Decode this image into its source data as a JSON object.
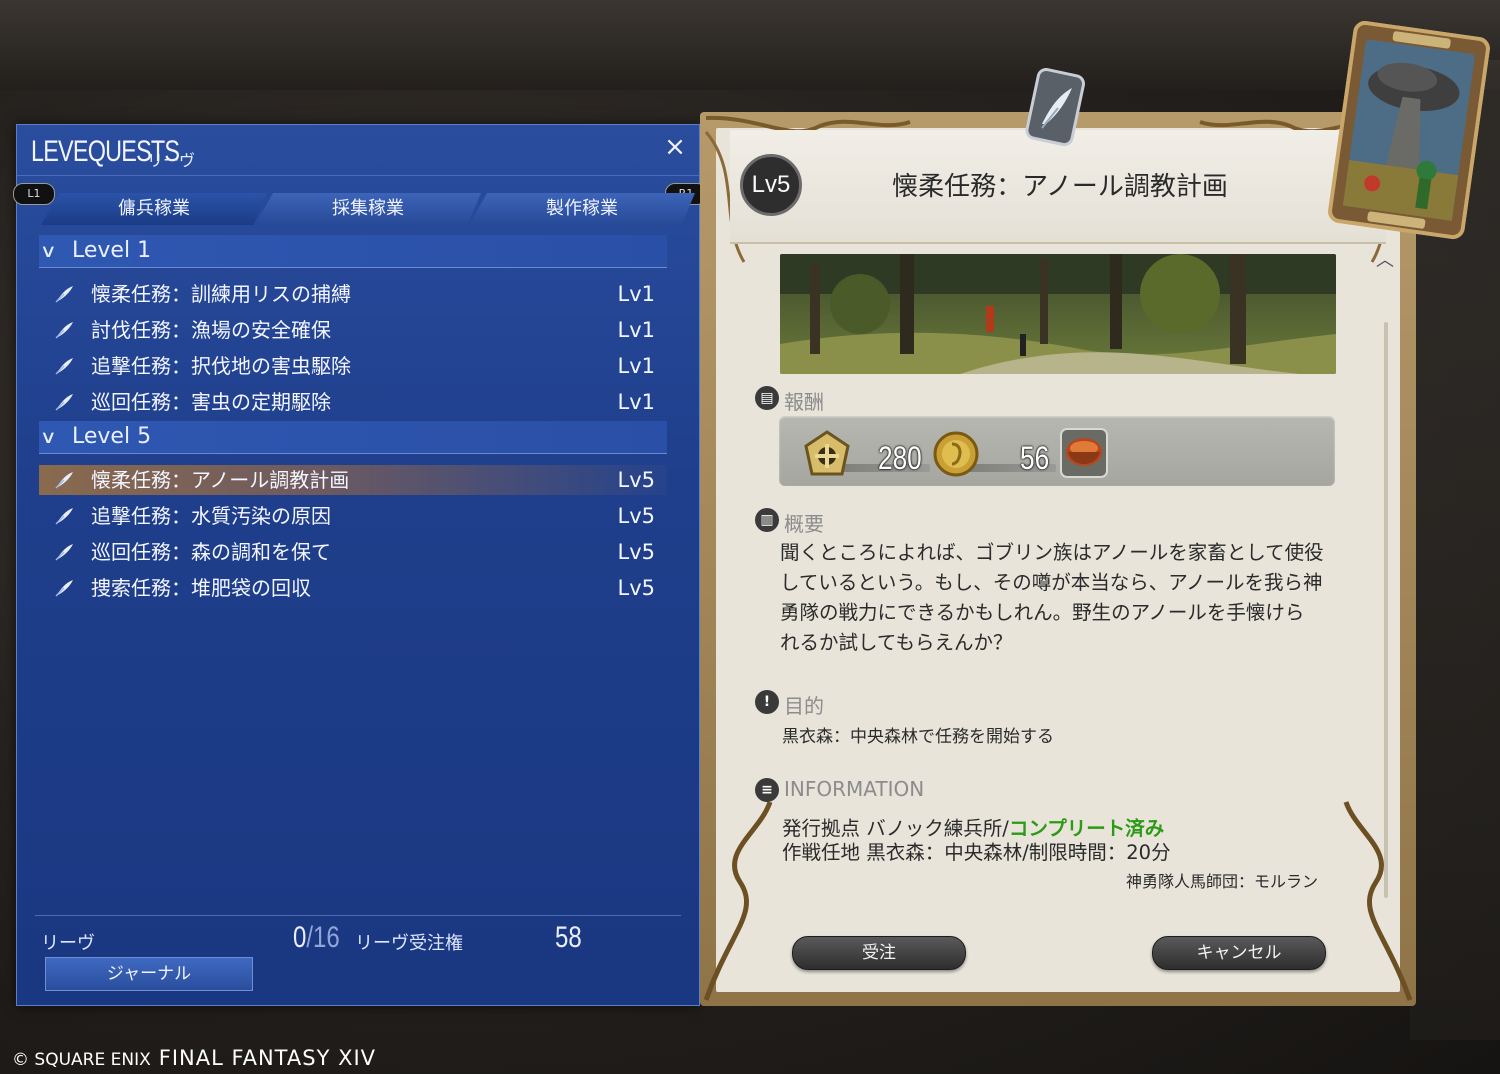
{
  "leve_window": {
    "title": "LEVEQUESTS",
    "subtitle": "リーヴ",
    "close_glyph": "×",
    "shoulder_left": "L1",
    "shoulder_right": "R1",
    "tabs": [
      {
        "label": "傭兵稼業",
        "active": true
      },
      {
        "label": "採集稼業",
        "active": false
      },
      {
        "label": "製作稼業",
        "active": false
      }
    ],
    "groups": [
      {
        "label": "Level 1",
        "quests": [
          {
            "name": "懐柔任務：訓練用リスの捕縛",
            "level": "Lv1"
          },
          {
            "name": "討伐任務：漁場の安全確保",
            "level": "Lv1"
          },
          {
            "name": "追撃任務：択伐地の害虫駆除",
            "level": "Lv1"
          },
          {
            "name": "巡回任務：害虫の定期駆除",
            "level": "Lv1"
          }
        ]
      },
      {
        "label": "Level 5",
        "quests": [
          {
            "name": "懐柔任務：アノール調教計画",
            "level": "Lv5",
            "selected": true
          },
          {
            "name": "追撃任務：水質汚染の原因",
            "level": "Lv5"
          },
          {
            "name": "巡回任務：森の調和を保て",
            "level": "Lv5"
          },
          {
            "name": "捜索任務：堆肥袋の回収",
            "level": "Lv5"
          }
        ]
      }
    ],
    "footer": {
      "leve_label": "リーヴ",
      "leve_current": "0",
      "leve_total": "/16",
      "allowance_label": "リーヴ受注権",
      "allowance_value": "58",
      "journal_button": "ジャーナル"
    }
  },
  "detail": {
    "level_badge": "Lv5",
    "title": "懐柔任務：アノール調教計画",
    "rewards_label": "報酬",
    "rewards": [
      {
        "icon": "exp-icon",
        "value": "280"
      },
      {
        "icon": "gil-coin-icon",
        "value": "56"
      },
      {
        "icon": "item-bowl-icon",
        "value": ""
      }
    ],
    "summary_label": "概要",
    "summary_lines": [
      "聞くところによれば、ゴブリン族はアノールを家畜として使役",
      "しているという。もし、その噂が本当なら、アノールを我ら神",
      "勇隊の戦力にできるかもしれん。野生のアノールを手懐けら",
      "れるか試してもらえんか？"
    ],
    "objective_label": "目的",
    "objective_text": "黒衣森：中央森林で任務を開始する",
    "info_label": "INFORMATION",
    "info_line1_prefix": "発行拠点 バノック練兵所/",
    "info_line1_status": "コンプリート済み",
    "info_line2": "作戦任地 黒衣森：中央森林/制限時間：20分",
    "info_client": "神勇隊人馬師団：モルラン",
    "accept_button": "受注",
    "cancel_button": "キャンセル"
  },
  "copyright": {
    "company": "© SQUARE ENIX",
    "game": "FINAL FANTASY XIV"
  },
  "colors": {
    "window_blue": "#1f3f8c",
    "paper": "#e8e4da",
    "frame_gold": "#b69a6a",
    "complete_green": "#2b9a14"
  }
}
